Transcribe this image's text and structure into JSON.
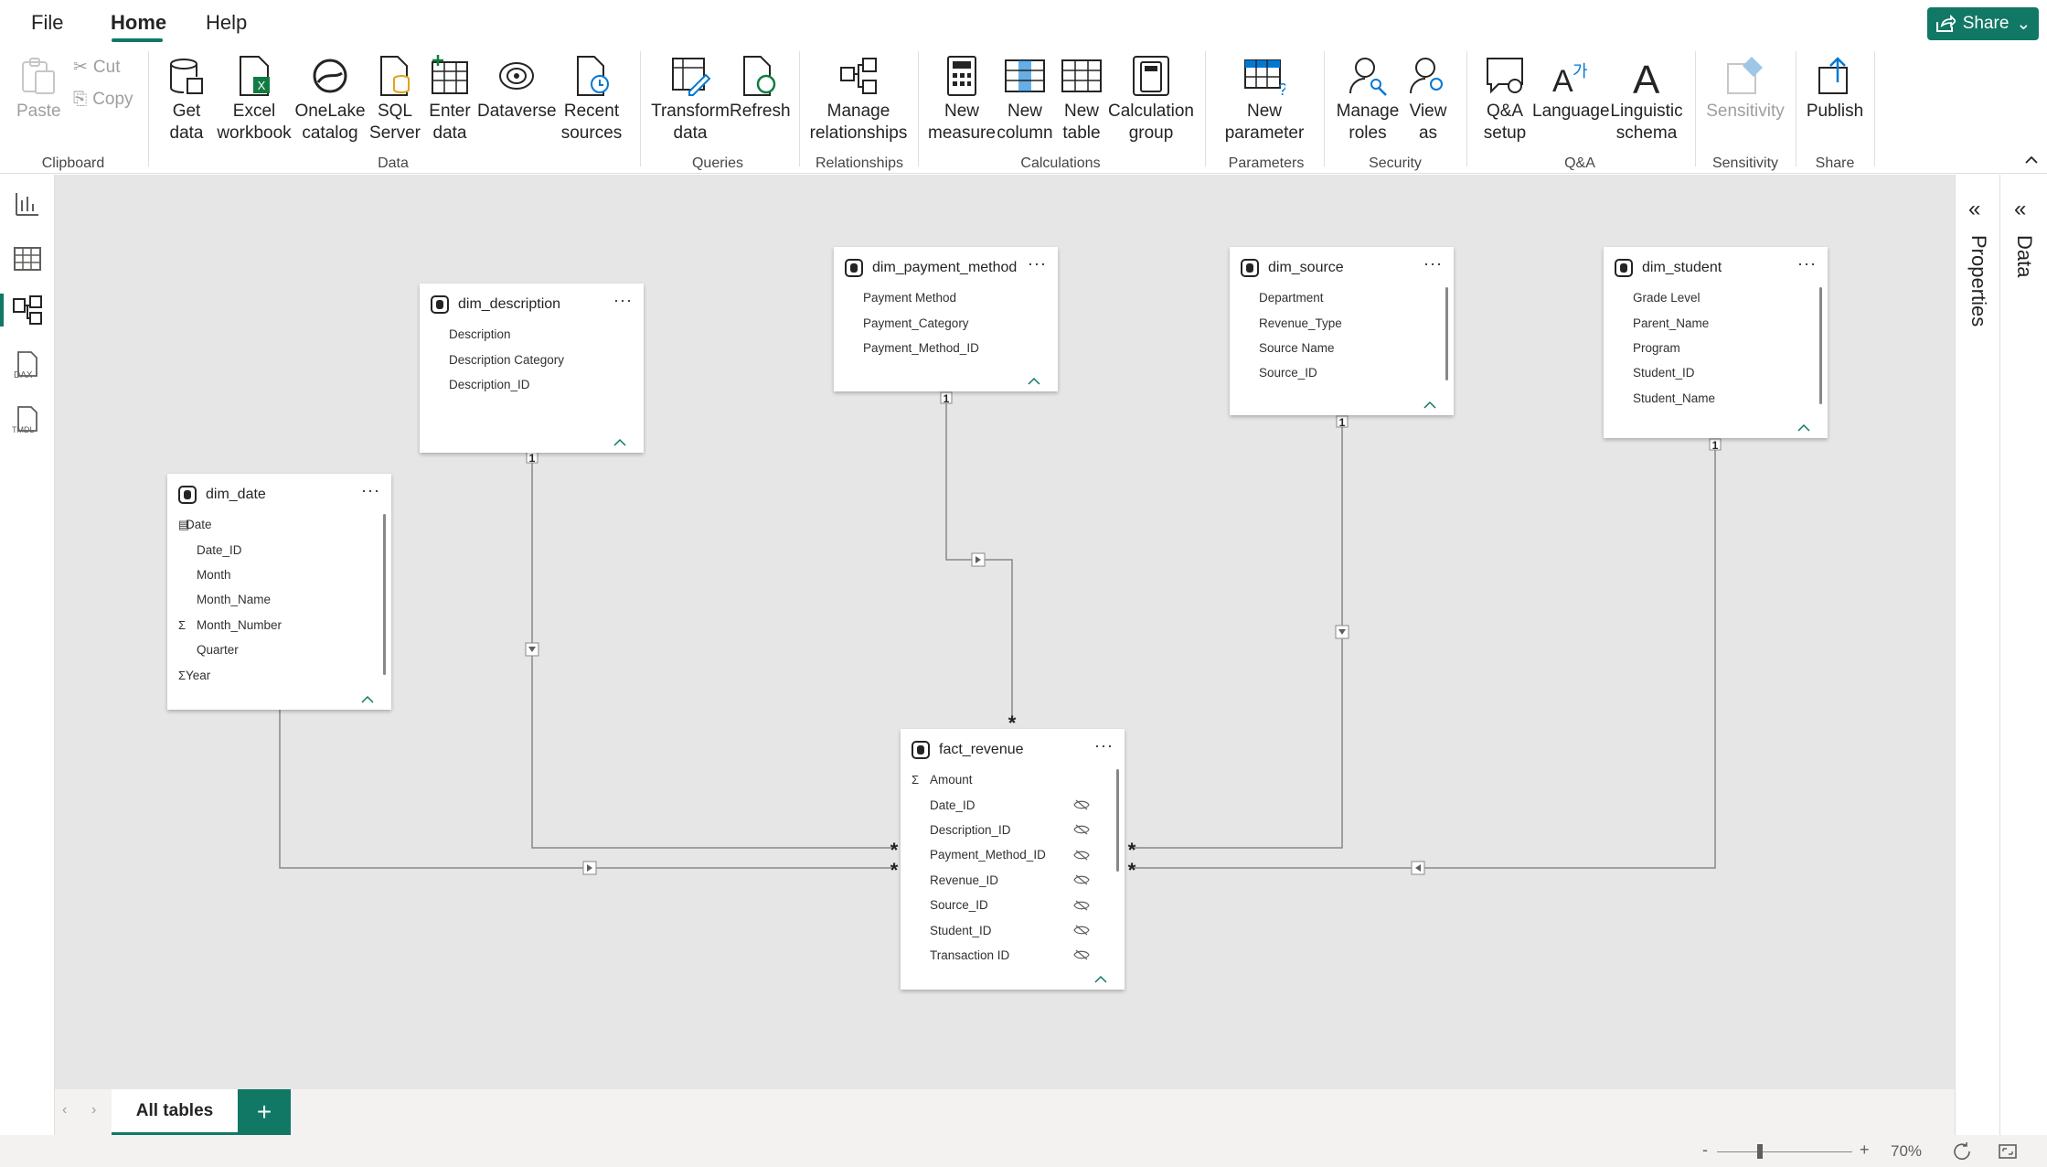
{
  "menu": {
    "file": "File",
    "home": "Home",
    "help": "Help",
    "share": "Share"
  },
  "ribbon": {
    "clipboard": {
      "paste": "Paste",
      "cut": "Cut",
      "copy": "Copy",
      "group": "Clipboard"
    },
    "data": {
      "get_data": "Get data",
      "excel": "Excel workbook",
      "onelake": "OneLake catalog",
      "sql": "SQL Server",
      "enter": "Enter data",
      "dataverse": "Dataverse",
      "recent": "Recent sources",
      "group": "Data"
    },
    "queries": {
      "transform": "Transform data",
      "refresh": "Refresh",
      "group": "Queries"
    },
    "relationships": {
      "manage": "Manage relationships",
      "group": "Relationships"
    },
    "calculations": {
      "measure": "New measure",
      "column": "New column",
      "table": "New table",
      "calc_group": "Calculation group",
      "group": "Calculations"
    },
    "parameters": {
      "new_param": "New parameter",
      "group": "Parameters"
    },
    "security": {
      "roles": "Manage roles",
      "view_as": "View as",
      "group": "Security"
    },
    "qa": {
      "setup": "Q&A setup",
      "language": "Language",
      "schema": "Linguistic schema",
      "group": "Q&A"
    },
    "sensitivity": {
      "label": "Sensitivity",
      "group": "Sensitivity"
    },
    "share": {
      "publish": "Publish",
      "group": "Share"
    }
  },
  "right_pane": {
    "properties": "Properties",
    "data": "Data"
  },
  "tables": {
    "dim_description": {
      "name": "dim_description",
      "fields": [
        "Description",
        "Description Category",
        "Description_ID"
      ]
    },
    "dim_payment_method": {
      "name": "dim_payment_method",
      "fields": [
        "Payment Method",
        "Payment_Category",
        "Payment_Method_ID"
      ]
    },
    "dim_source": {
      "name": "dim_source",
      "fields": [
        "Department",
        "Revenue_Type",
        "Source Name",
        "Source_ID"
      ]
    },
    "dim_student": {
      "name": "dim_student",
      "fields": [
        "Grade Level",
        "Parent_Name",
        "Program",
        "Student_ID",
        "Student_Name"
      ]
    },
    "dim_date": {
      "name": "dim_date",
      "fields": [
        "Date",
        "Date_ID",
        "Month",
        "Month_Name",
        "Month_Number",
        "Quarter",
        "Year"
      ]
    },
    "fact_revenue": {
      "name": "fact_revenue",
      "fields": [
        "Amount",
        "Date_ID",
        "Description_ID",
        "Payment_Method_ID",
        "Revenue_ID",
        "Source_ID",
        "Student_ID",
        "Transaction ID"
      ]
    }
  },
  "relationships": {
    "one": "1",
    "many": "*"
  },
  "bottom": {
    "tab": "All tables",
    "add": "+",
    "zoom": "70%"
  }
}
